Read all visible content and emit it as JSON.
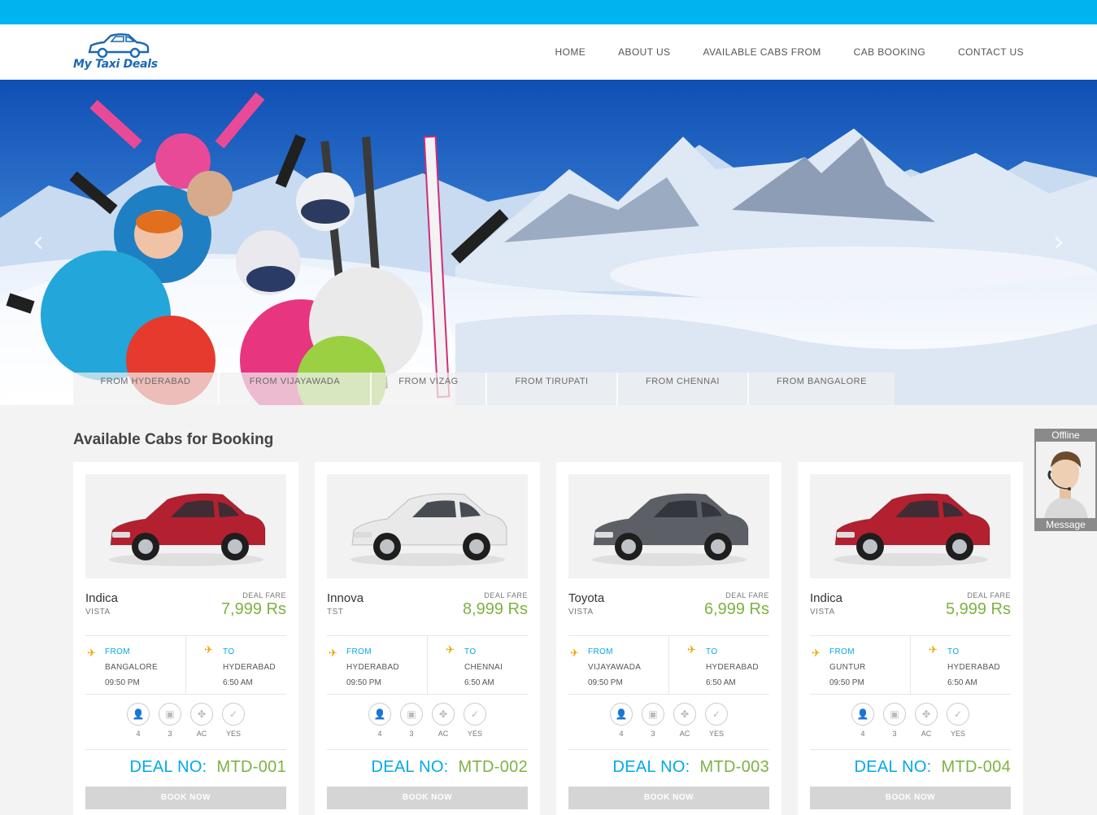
{
  "brand": {
    "logo_text": "My Taxi Deals"
  },
  "nav": {
    "items": [
      {
        "label": "HOME"
      },
      {
        "label": "ABOUT US"
      },
      {
        "label": "AVAILABLE CABS FROM"
      },
      {
        "label": "CAB BOOKING"
      },
      {
        "label": "CONTACT US"
      }
    ]
  },
  "hero": {
    "prev_icon": "chevron-left-icon",
    "next_icon": "chevron-right-icon",
    "tabs": [
      {
        "label": "FROM HYDERABAD"
      },
      {
        "label": "FROM VIJAYAWADA"
      },
      {
        "label": "FROM VIZAG"
      },
      {
        "label": "FROM TIRUPATI"
      },
      {
        "label": "FROM CHENNAI"
      },
      {
        "label": "FROM BANGALORE"
      }
    ]
  },
  "section": {
    "title": "Available Cabs for Booking"
  },
  "cards": [
    {
      "name": "Indica",
      "variant": "VISTA",
      "fare_label": "DEAL FARE",
      "fare": "7,999 Rs",
      "car_color": "#b3202f",
      "from_label": "FROM",
      "from_city": "BANGALORE",
      "from_time": "09:50 PM",
      "to_label": "TO",
      "to_city": "HYDERABAD",
      "to_time": "6:50 AM",
      "features": [
        "4",
        "3",
        "AC",
        "YES"
      ],
      "deal_label": "DEAL NO:",
      "deal_no": "MTD-001",
      "book_label": "BOOK NOW"
    },
    {
      "name": "Innova",
      "variant": "TST",
      "fare_label": "DEAL FARE",
      "fare": "8,999 Rs",
      "car_color": "#e9e9e9",
      "from_label": "FROM",
      "from_city": "HYDERABAD",
      "from_time": "09:50 PM",
      "to_label": "TO",
      "to_city": "CHENNAI",
      "to_time": "6:50 AM",
      "features": [
        "4",
        "3",
        "AC",
        "YES"
      ],
      "deal_label": "DEAL NO:",
      "deal_no": "MTD-002",
      "book_label": "BOOK NOW"
    },
    {
      "name": "Toyota",
      "variant": "VISTA",
      "fare_label": "DEAL FARE",
      "fare": "6,999 Rs",
      "car_color": "#5c6066",
      "from_label": "FROM",
      "from_city": "VIJAYAWADA",
      "from_time": "09:50 PM",
      "to_label": "TO",
      "to_city": "HYDERABAD",
      "to_time": "6:50 AM",
      "features": [
        "4",
        "3",
        "AC",
        "YES"
      ],
      "deal_label": "DEAL NO:",
      "deal_no": "MTD-003",
      "book_label": "BOOK NOW"
    },
    {
      "name": "Indica",
      "variant": "VISTA",
      "fare_label": "DEAL FARE",
      "fare": "5,999 Rs",
      "car_color": "#b3202f",
      "from_label": "FROM",
      "from_city": "GUNTUR",
      "from_time": "09:50 PM",
      "to_label": "TO",
      "to_city": "HYDERABAD",
      "to_time": "6:50 AM",
      "features": [
        "4",
        "3",
        "AC",
        "YES"
      ],
      "deal_label": "DEAL NO:",
      "deal_no": "MTD-004",
      "book_label": "BOOK NOW"
    }
  ],
  "feature_icons": [
    "person-icon",
    "luggage-icon",
    "fan-icon",
    "check-icon"
  ],
  "chat": {
    "status": "Offline",
    "action": "Message"
  },
  "colors": {
    "topbar": "#00b4ef",
    "accent_blue": "#00a9e8",
    "accent_green": "#7cb342",
    "plane": "#f0a500"
  }
}
